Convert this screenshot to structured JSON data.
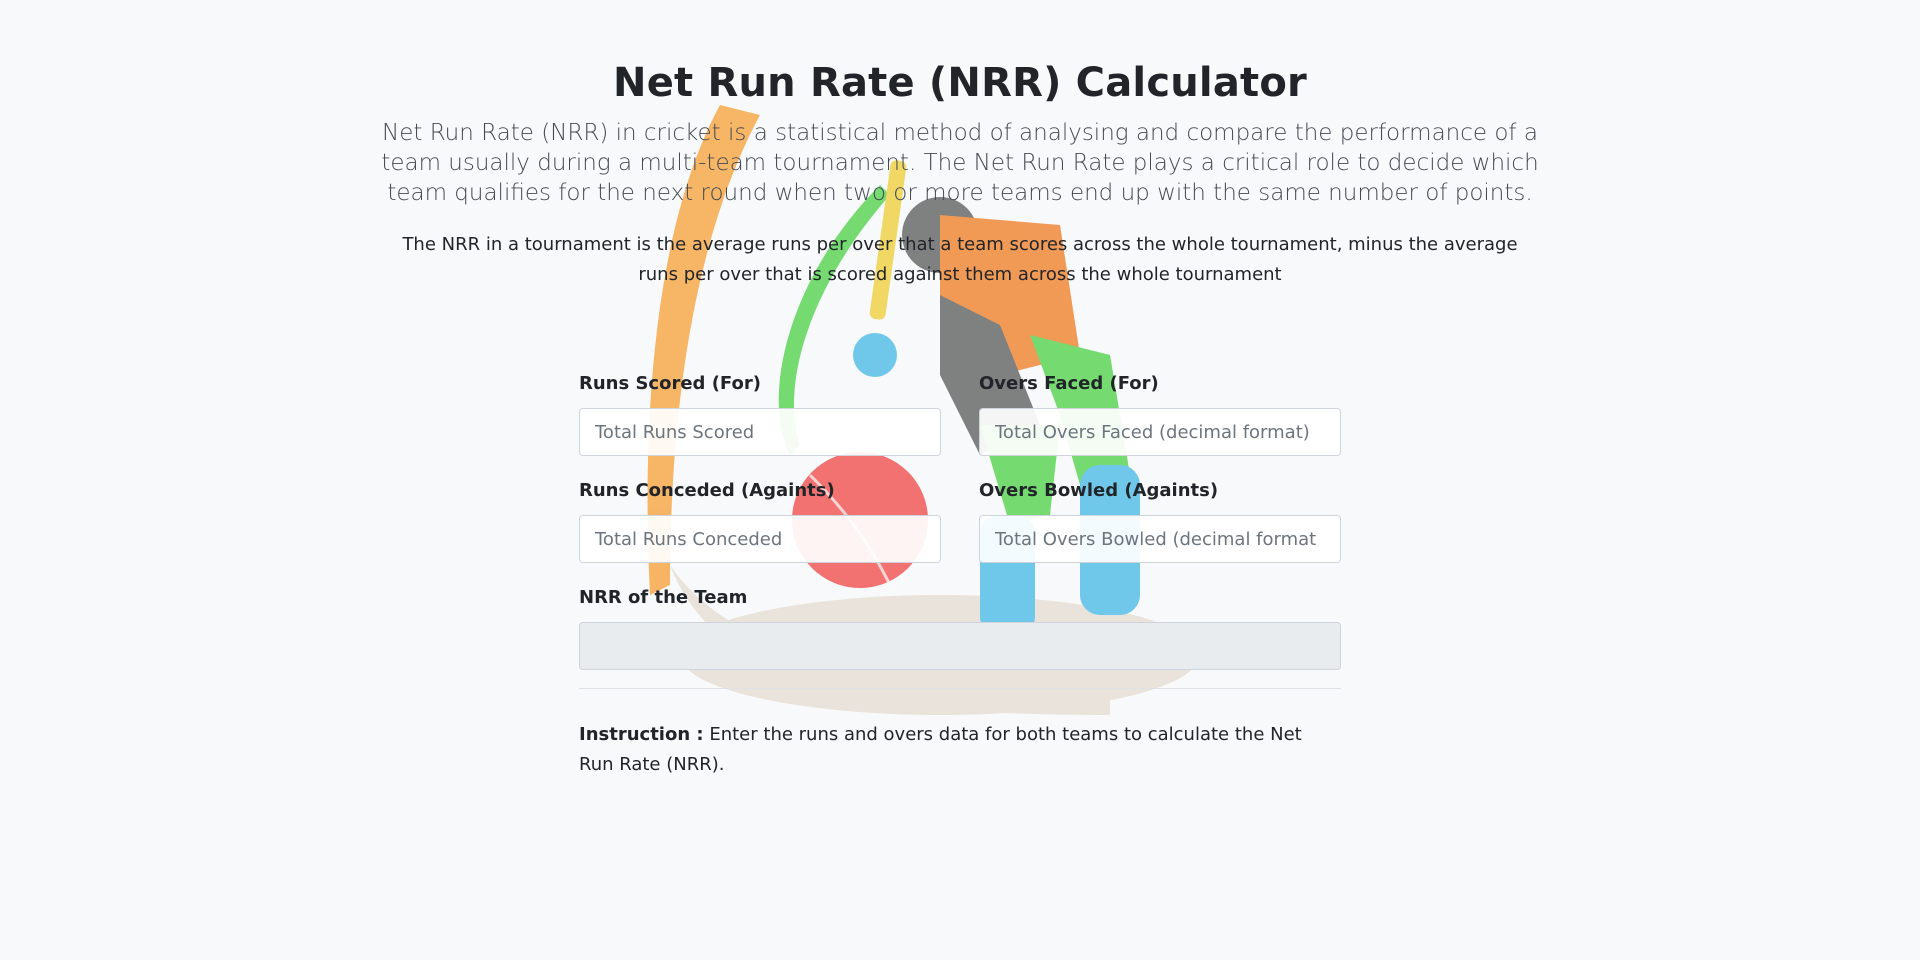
{
  "page": {
    "title": "Net Run Rate (NRR) Calculator",
    "lead": "Net Run Rate (NRR) in cricket is a statistical method of analysing and compare the performance of a team usually during a multi-team tournament. The Net Run Rate plays a critical role to decide which team qualifies for the next round when two or more teams end up with the same number of points.",
    "description": "The NRR in a tournament is the average runs per over that a team scores across the whole tournament, minus the average runs per over that is scored against them across the whole tournament"
  },
  "form": {
    "runs_scored": {
      "label": "Runs Scored (For)",
      "placeholder": "Total Runs Scored",
      "value": ""
    },
    "overs_faced": {
      "label": "Overs Faced (For)",
      "placeholder": "Total Overs Faced (decimal format)",
      "value": ""
    },
    "runs_conceded": {
      "label": "Runs Conceded (Againts)",
      "placeholder": "Total Runs Conceded",
      "value": ""
    },
    "overs_bowled": {
      "label": "Overs Bowled (Againts)",
      "placeholder": "Total Overs Bowled (decimal format",
      "value": ""
    },
    "nrr": {
      "label": "NRR of the Team",
      "value": ""
    }
  },
  "instruction": {
    "label": "Instruction :",
    "text": " Enter the runs and overs data for both teams to calculate the Net Run Rate (NRR)."
  },
  "background_art": {
    "icon": "cricket-batsman-illustration",
    "colors": [
      "#f7a94b",
      "#5fd65a",
      "#f25a5a",
      "#58c0e8",
      "#6b6b6b",
      "#e8e0d6"
    ]
  }
}
